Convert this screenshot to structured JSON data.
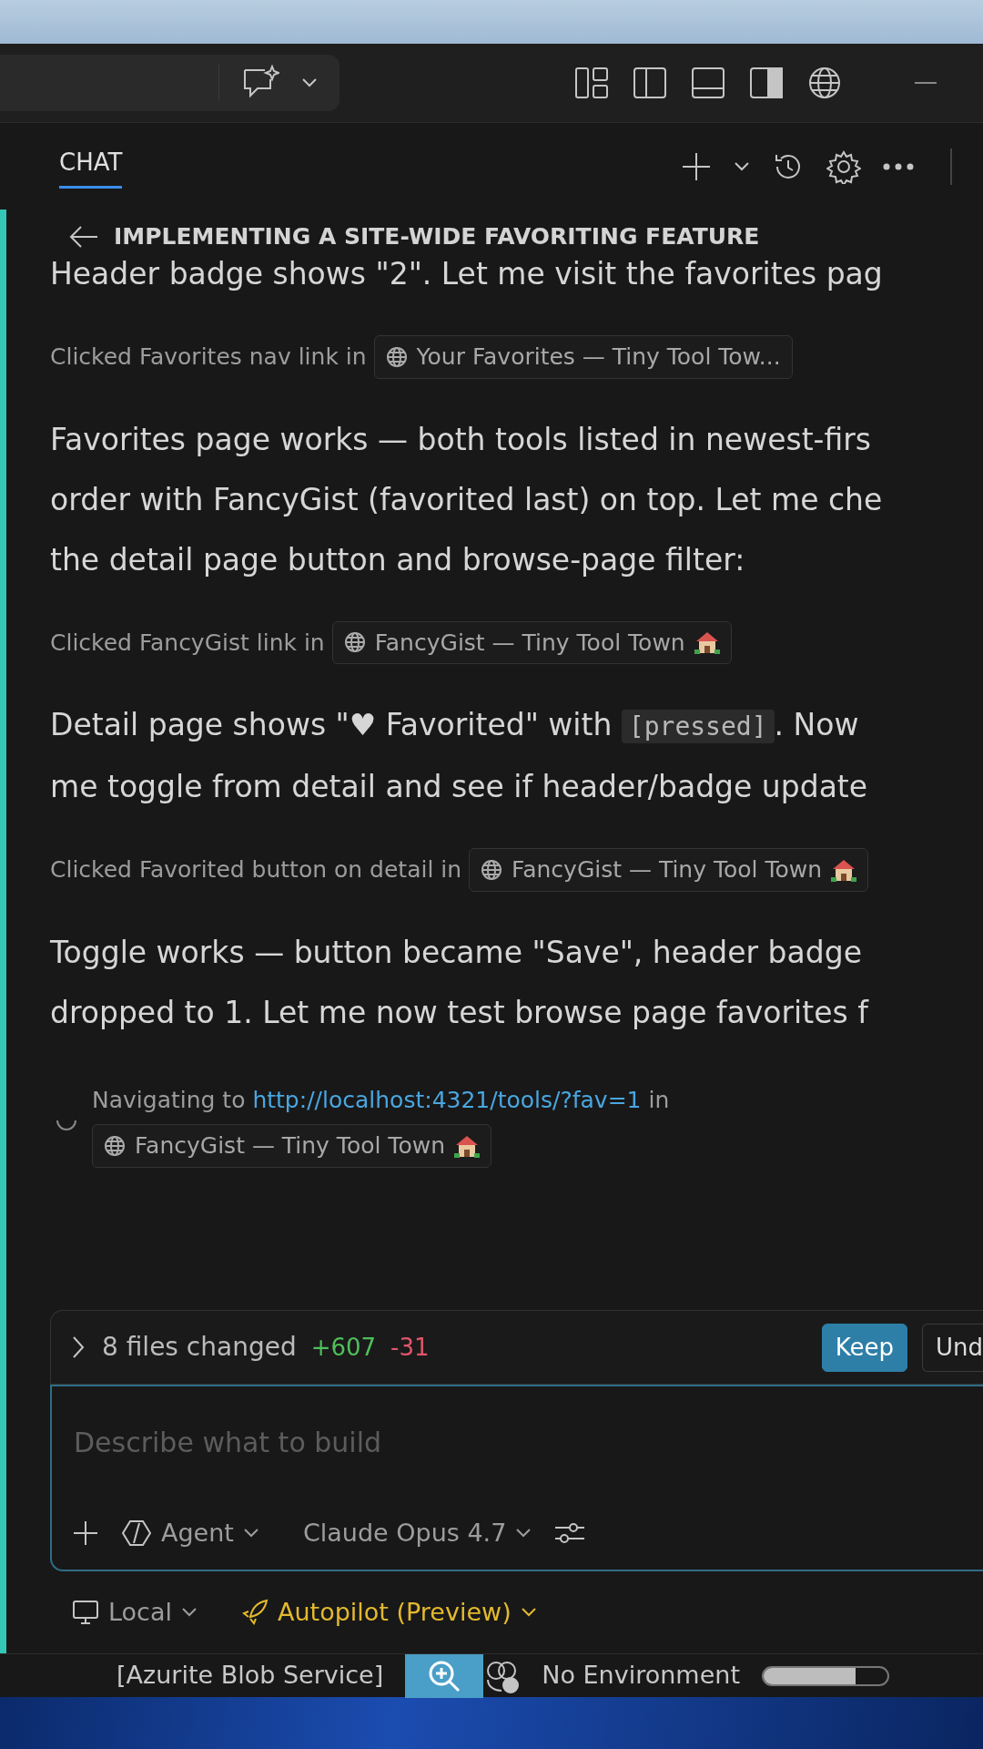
{
  "chat_tab": {
    "label": "CHAT",
    "selected": true
  },
  "session_title": "IMPLEMENTING A SITE-WIDE FAVORITING FEATURE",
  "messages": [
    {
      "kind": "text",
      "lines": [
        [
          {
            "kind": "text",
            "text": "Header badge shows \"2\". Let me visit the favorites pag"
          }
        ]
      ]
    },
    {
      "kind": "tool",
      "text": "Clicked Favorites nav link in",
      "chip": {
        "label": "Your Favorites — Tiny Tool Tow...",
        "house": false
      }
    },
    {
      "kind": "text",
      "lines": [
        [
          {
            "kind": "text",
            "text": "Favorites page works — both tools listed in newest-firs"
          }
        ],
        [
          {
            "kind": "text",
            "text": "order with FancyGist (favorited last) on top. Let me che"
          }
        ],
        [
          {
            "kind": "text",
            "text": "the detail page button and browse-page filter:"
          }
        ]
      ]
    },
    {
      "kind": "tool",
      "text": "Clicked FancyGist link in",
      "chip": {
        "label": "FancyGist — Tiny Tool Town",
        "house": true
      }
    },
    {
      "kind": "text",
      "lines": [
        [
          {
            "kind": "text",
            "text": "Detail page shows \"♥ Favorited\" with "
          },
          {
            "kind": "code",
            "text": "[pressed]"
          },
          {
            "kind": "text",
            "text": ". Now"
          }
        ],
        [
          {
            "kind": "text",
            "text": "me toggle from detail and see if header/badge update"
          }
        ]
      ]
    },
    {
      "kind": "tool",
      "text": "Clicked Favorited button on detail in",
      "chip": {
        "label": "FancyGist — Tiny Tool Town",
        "house": true
      }
    },
    {
      "kind": "text",
      "lines": [
        [
          {
            "kind": "text",
            "text": "Toggle works — button became \"Save\", header badge"
          }
        ],
        [
          {
            "kind": "text",
            "text": "dropped to 1. Let me now test browse page favorites f"
          }
        ]
      ]
    },
    {
      "kind": "nav",
      "prefix": "Navigating to",
      "link": "http://localhost:4321/tools/?fav=1",
      "suffix": "in",
      "chip": {
        "label": "FancyGist — Tiny Tool Town",
        "house": true
      }
    }
  ],
  "changes": {
    "summary": "8 files changed",
    "added": "+607",
    "removed": "-31",
    "expanded": false
  },
  "buttons": [
    {
      "label": "Keep",
      "primary": true
    },
    {
      "label": "Und",
      "primary": false
    }
  ],
  "input": {
    "placeholder": "Describe what to build"
  },
  "mode": "Agent",
  "model": "Claude Opus 4.7",
  "location": "Local",
  "autopilot": "Autopilot (Preview)",
  "status_bar": {
    "service": "[Azurite Blob Service]",
    "environment": "No Environment",
    "progress": {
      "level": 0.74
    }
  }
}
